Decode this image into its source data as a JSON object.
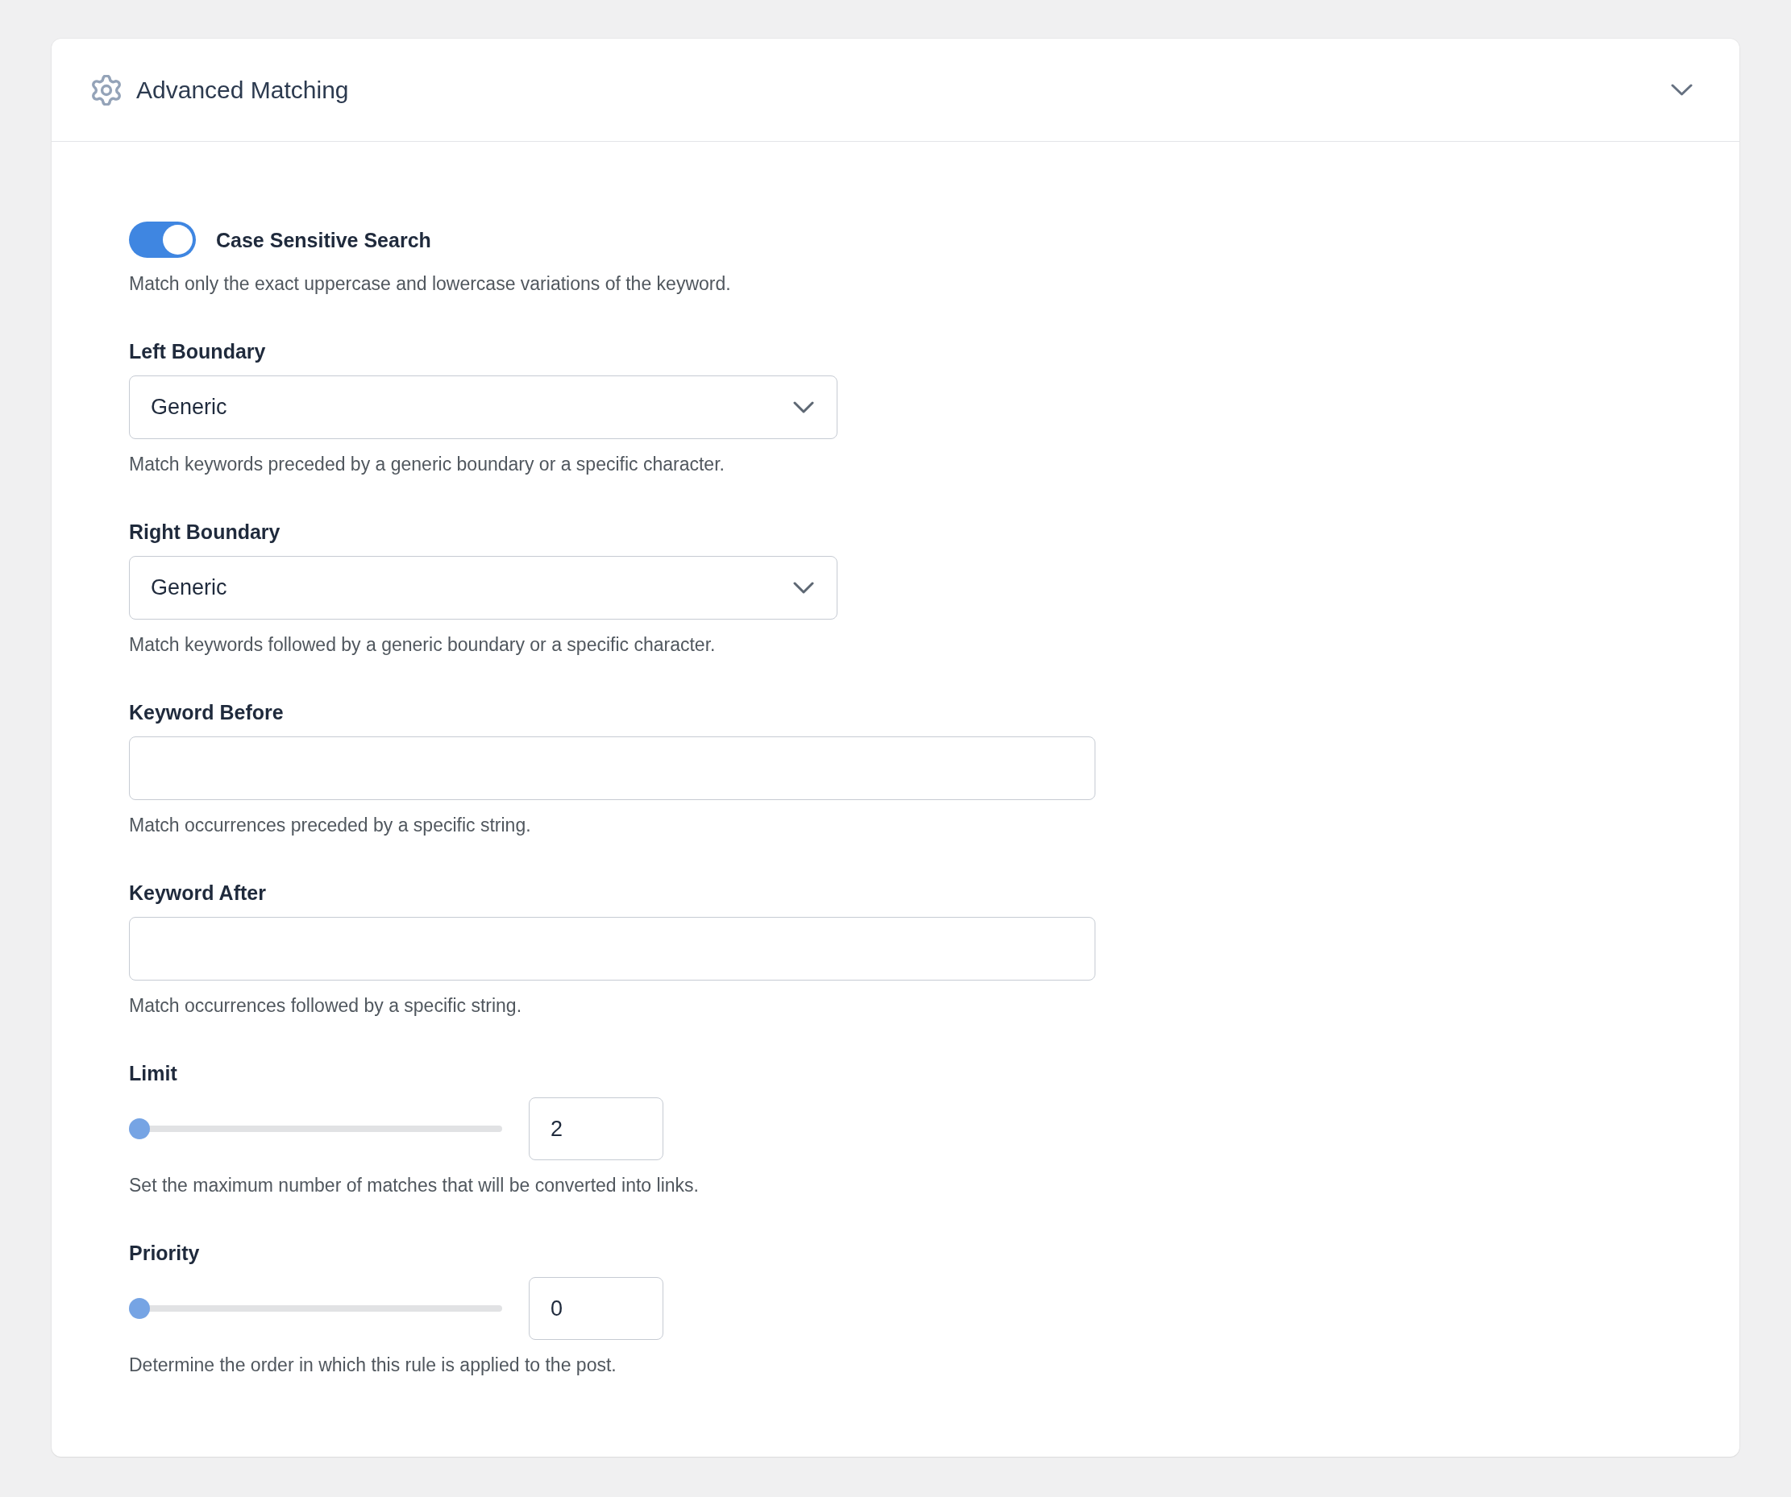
{
  "panel": {
    "title": "Advanced Matching",
    "expanded": true
  },
  "settings": [
    {
      "kind": "toggle",
      "label": "Case Sensitive Search",
      "on": true,
      "description": "Match only the exact uppercase and lowercase variations of the keyword."
    },
    {
      "kind": "select",
      "label": "Left Boundary",
      "value": "Generic",
      "description": "Match keywords preceded by a generic boundary or a specific character."
    },
    {
      "kind": "select",
      "label": "Right Boundary",
      "value": "Generic",
      "description": "Match keywords followed by a generic boundary or a specific character."
    },
    {
      "kind": "text",
      "label": "Keyword Before",
      "description": "Match occurrences preceded by a specific string."
    },
    {
      "kind": "text",
      "label": "Keyword After",
      "description": "Match occurrences followed by a specific string."
    },
    {
      "kind": "slider",
      "label": "Limit",
      "level": 0,
      "value": "2",
      "description": "Set the maximum number of matches that will be converted into links."
    },
    {
      "kind": "slider",
      "label": "Priority",
      "level": 0,
      "value": "0",
      "description": "Determine the order in which this rule is applied to the post."
    }
  ]
}
